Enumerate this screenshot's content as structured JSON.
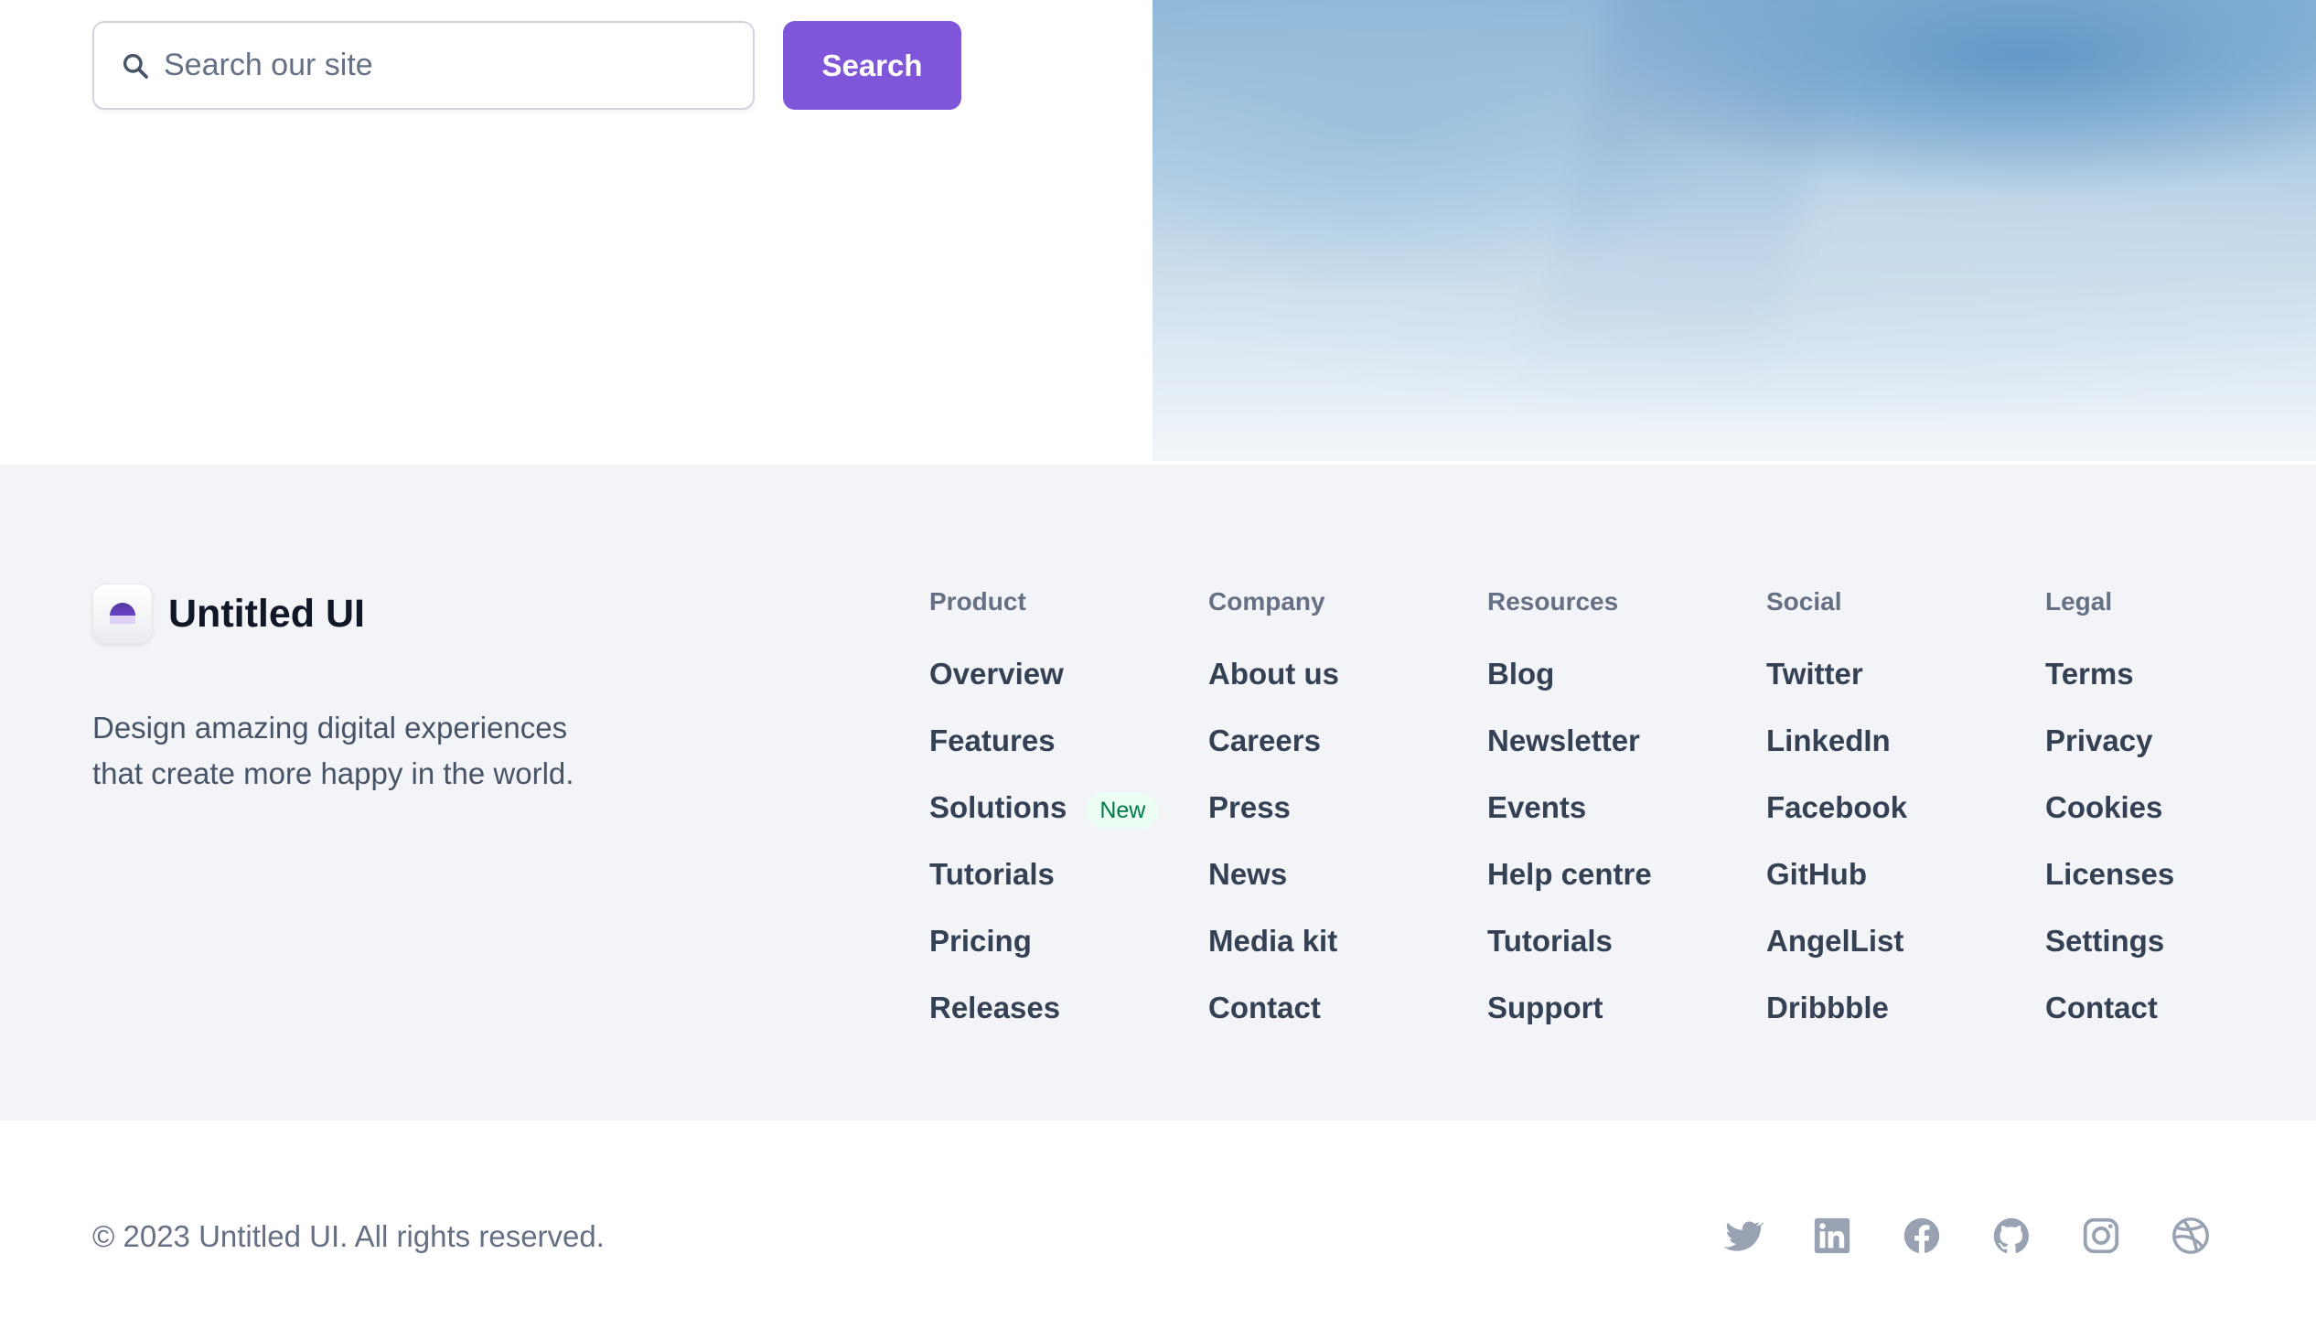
{
  "search": {
    "placeholder": "Search our site",
    "button_label": "Search",
    "icon": "search-icon"
  },
  "brand": {
    "name": "Untitled UI",
    "tagline": "Design amazing digital experiences that create more happy in the world.",
    "logo_icon": "half-circle-logo-icon"
  },
  "columns": [
    {
      "title": "Product",
      "links": [
        {
          "label": "Overview"
        },
        {
          "label": "Features"
        },
        {
          "label": "Solutions",
          "badge": "New"
        },
        {
          "label": "Tutorials"
        },
        {
          "label": "Pricing"
        },
        {
          "label": "Releases"
        }
      ]
    },
    {
      "title": "Company",
      "links": [
        {
          "label": "About us"
        },
        {
          "label": "Careers"
        },
        {
          "label": "Press"
        },
        {
          "label": "News"
        },
        {
          "label": "Media kit"
        },
        {
          "label": "Contact"
        }
      ]
    },
    {
      "title": "Resources",
      "links": [
        {
          "label": "Blog"
        },
        {
          "label": "Newsletter"
        },
        {
          "label": "Events"
        },
        {
          "label": "Help centre"
        },
        {
          "label": "Tutorials"
        },
        {
          "label": "Support"
        }
      ]
    },
    {
      "title": "Social",
      "links": [
        {
          "label": "Twitter"
        },
        {
          "label": "LinkedIn"
        },
        {
          "label": "Facebook"
        },
        {
          "label": "GitHub"
        },
        {
          "label": "AngelList"
        },
        {
          "label": "Dribbble"
        }
      ]
    },
    {
      "title": "Legal",
      "links": [
        {
          "label": "Terms"
        },
        {
          "label": "Privacy"
        },
        {
          "label": "Cookies"
        },
        {
          "label": "Licenses"
        },
        {
          "label": "Settings"
        },
        {
          "label": "Contact"
        }
      ]
    }
  ],
  "footer": {
    "copyright": "© 2023 Untitled UI. All rights reserved.",
    "social_icons": [
      "twitter-icon",
      "linkedin-icon",
      "facebook-icon",
      "github-icon",
      "instagram-icon",
      "dribbble-icon"
    ]
  },
  "colors": {
    "accent": "#7f56d9",
    "footer_bg": "#f2f4f7",
    "link": "#344054",
    "muted": "#667085",
    "badge_bg": "#ecfdf3",
    "badge_text": "#027a48"
  }
}
